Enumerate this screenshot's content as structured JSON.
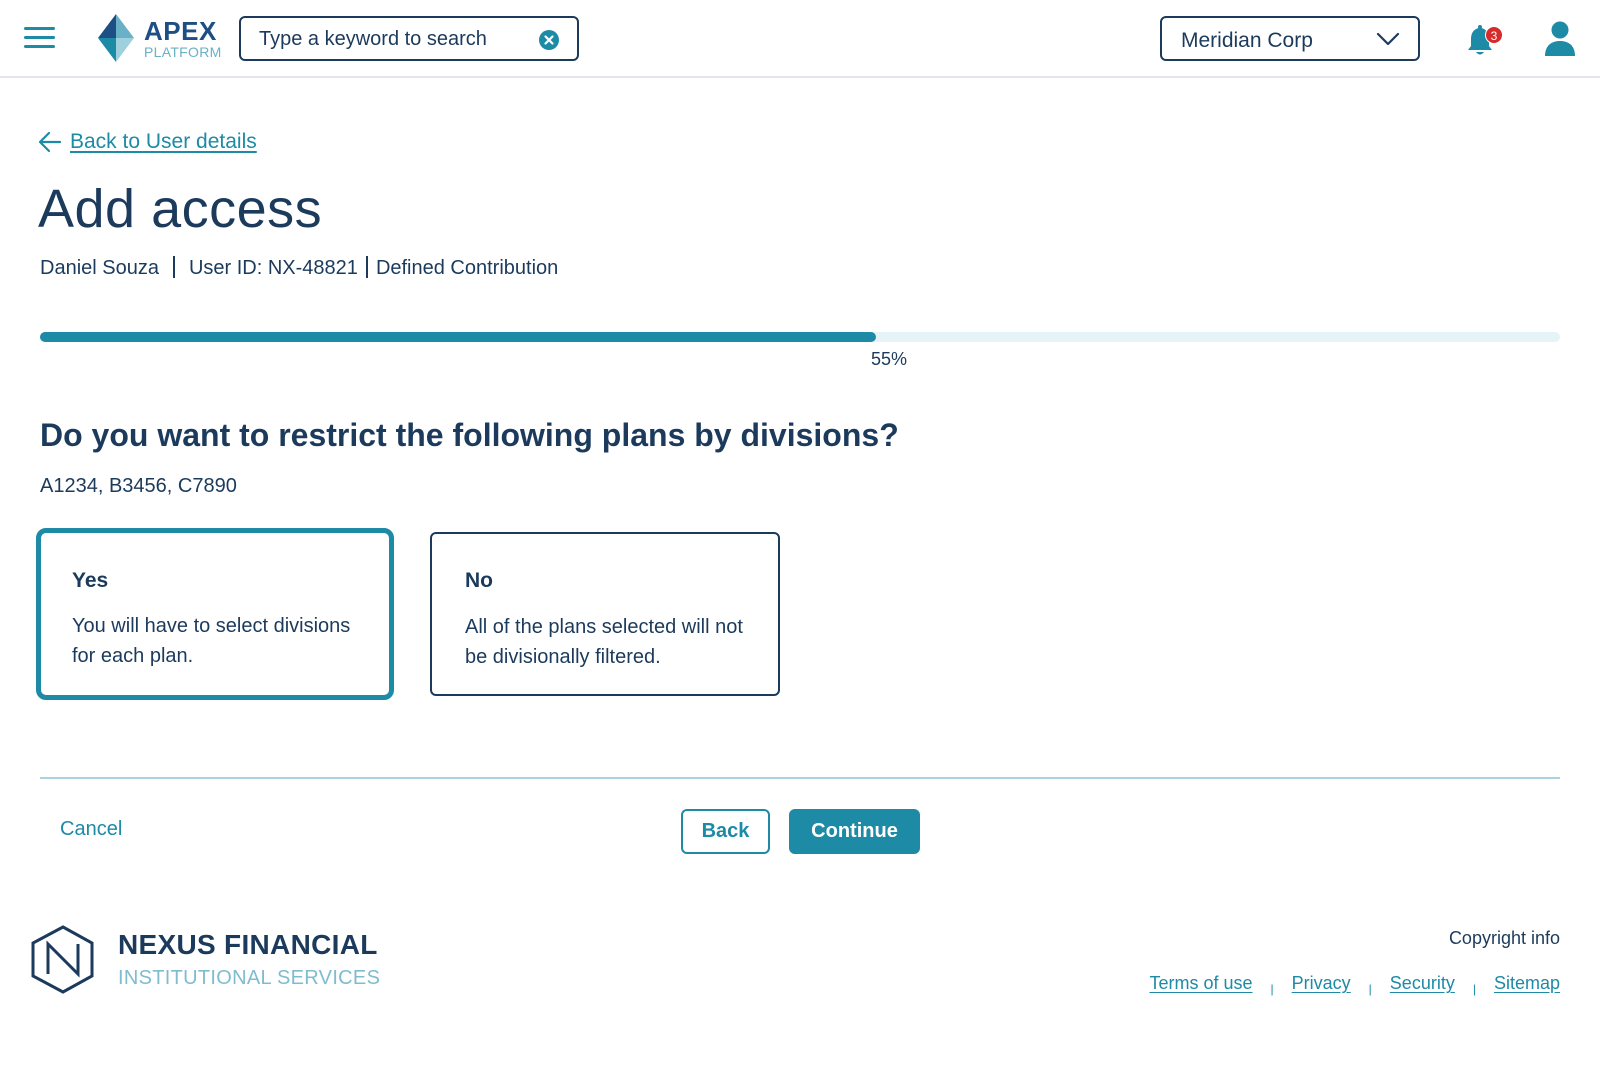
{
  "header": {
    "logo_name": "APEX",
    "logo_sub": "PLATFORM",
    "search_placeholder": "Type a keyword to search",
    "org_selected": "Meridian Corp",
    "notification_count": "3"
  },
  "breadcrumb": {
    "back_label": "Back to User details"
  },
  "page": {
    "title": "Add access",
    "user_name": "Daniel Souza",
    "user_id": "User ID: NX-48821",
    "plan_type": "Defined Contribution"
  },
  "progress": {
    "percent": 55,
    "label": "55%"
  },
  "question": {
    "text": "Do you want to restrict the following plans by divisions?",
    "plans": "A1234, B3456, C7890"
  },
  "options": [
    {
      "title": "Yes",
      "description": "You will have to select divisions for each plan.",
      "selected": true
    },
    {
      "title": "No",
      "description": "All of the plans selected will not be divisionally filtered.",
      "selected": false
    }
  ],
  "actions": {
    "cancel_label": "Cancel",
    "back_label": "Back",
    "continue_label": "Continue"
  },
  "footer": {
    "brand": "NEXUS FINANCIAL",
    "tagline": "INSTITUTIONAL SERVICES",
    "copyright": "Copyright info",
    "links": [
      "Terms of use",
      "Privacy",
      "Security",
      "Sitemap"
    ]
  },
  "colors": {
    "accent": "#1d8aa6",
    "navy": "#1b3a5c",
    "badge": "#d72a2a",
    "track": "#e6f3f7"
  },
  "icons": [
    "menu-icon",
    "apex-logo-icon",
    "clear-search-icon",
    "chevron-down-icon",
    "bell-icon",
    "user-icon",
    "arrow-left-icon",
    "nexus-logo-icon"
  ]
}
